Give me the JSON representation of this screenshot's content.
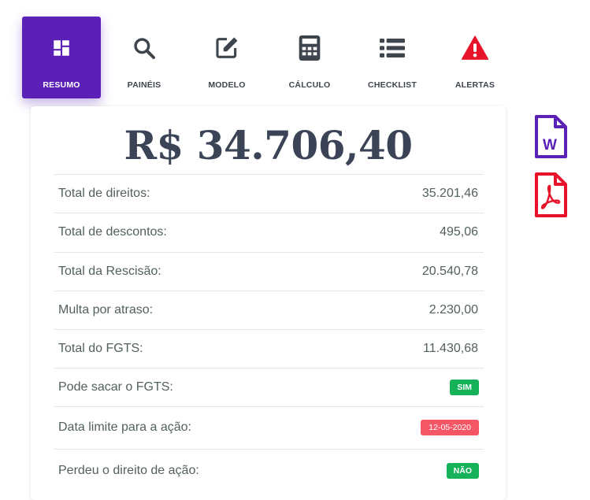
{
  "nav": {
    "items": [
      {
        "label": "RESUMO",
        "icon": "dashboard-icon",
        "active": true
      },
      {
        "label": "PAINÉIS",
        "icon": "search-icon",
        "active": false
      },
      {
        "label": "MODELO",
        "icon": "edit-icon",
        "active": false
      },
      {
        "label": "CÁLCULO",
        "icon": "calculator-icon",
        "active": false
      },
      {
        "label": "CHECKLIST",
        "icon": "list-icon",
        "active": false
      },
      {
        "label": "ALERTAS",
        "icon": "warning-icon",
        "active": false
      }
    ]
  },
  "summary": {
    "total": "R$ 34.706,40",
    "rows": [
      {
        "label": "Total de direitos:",
        "value": "35.201,46"
      },
      {
        "label": "Total de descontos:",
        "value": "495,06"
      },
      {
        "label": "Total da Rescisão:",
        "value": "20.540,78"
      },
      {
        "label": "Multa por atraso:",
        "value": "2.230,00"
      },
      {
        "label": "Total do FGTS:",
        "value": "11.430,68"
      },
      {
        "label": "Pode sacar o FGTS:",
        "value": "SIM"
      },
      {
        "label": "Data limite para a ação:",
        "value": "12-05-2020"
      },
      {
        "label": "Perdeu o direito de ação:",
        "value": "NÃO"
      }
    ]
  },
  "side": {
    "word_icon": "word-file-icon",
    "word_letter": "W",
    "pdf_icon": "pdf-file-icon"
  },
  "colors": {
    "accent": "#5b21b6",
    "icon_gray": "#3f454d",
    "alert_red": "#e8132a",
    "success": "#16b25a",
    "danger": "#f45666"
  }
}
